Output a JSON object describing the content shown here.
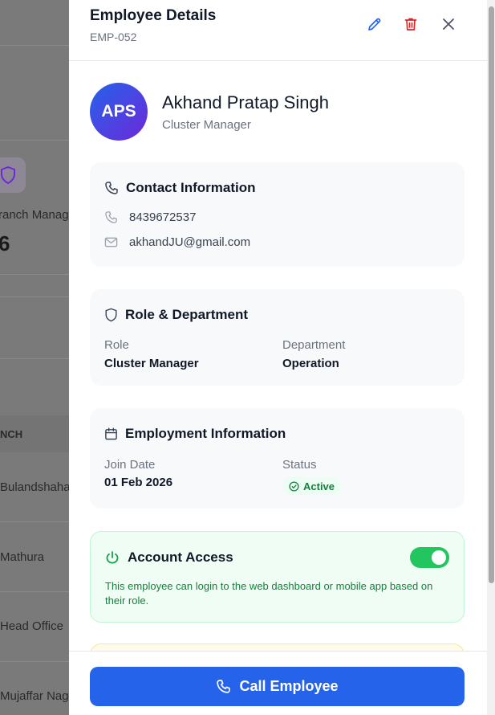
{
  "background": {
    "partial_label": "ranch Manag",
    "partial_number": "6",
    "table_header": "NCH",
    "rows": [
      "Bulandshaha",
      "Mathura",
      "Head Office",
      "Mujaffar Nag"
    ]
  },
  "header": {
    "title": "Employee Details",
    "employee_id": "EMP-052",
    "edit_icon": "pencil-icon",
    "delete_icon": "trash-icon",
    "close_icon": "close-icon"
  },
  "profile": {
    "initials": "APS",
    "name": "Akhand Pratap Singh",
    "role": "Cluster Manager"
  },
  "contact": {
    "title": "Contact Information",
    "phone": "8439672537",
    "email": "akhandJU@gmail.com"
  },
  "role_department": {
    "title": "Role & Department",
    "role_label": "Role",
    "role_value": "Cluster Manager",
    "department_label": "Department",
    "department_value": "Operation"
  },
  "employment": {
    "title": "Employment Information",
    "join_label": "Join Date",
    "join_value": "01 Feb 2026",
    "status_label": "Status",
    "status_value": "Active"
  },
  "account_access": {
    "title": "Account Access",
    "description": "This employee can login to the web dashboard or mobile app based on their role.",
    "enabled": true
  },
  "footer": {
    "call_label": "Call Employee"
  },
  "colors": {
    "primary": "#2563eb",
    "danger": "#dc2626",
    "success": "#22c55e",
    "success_text": "#15803d"
  }
}
